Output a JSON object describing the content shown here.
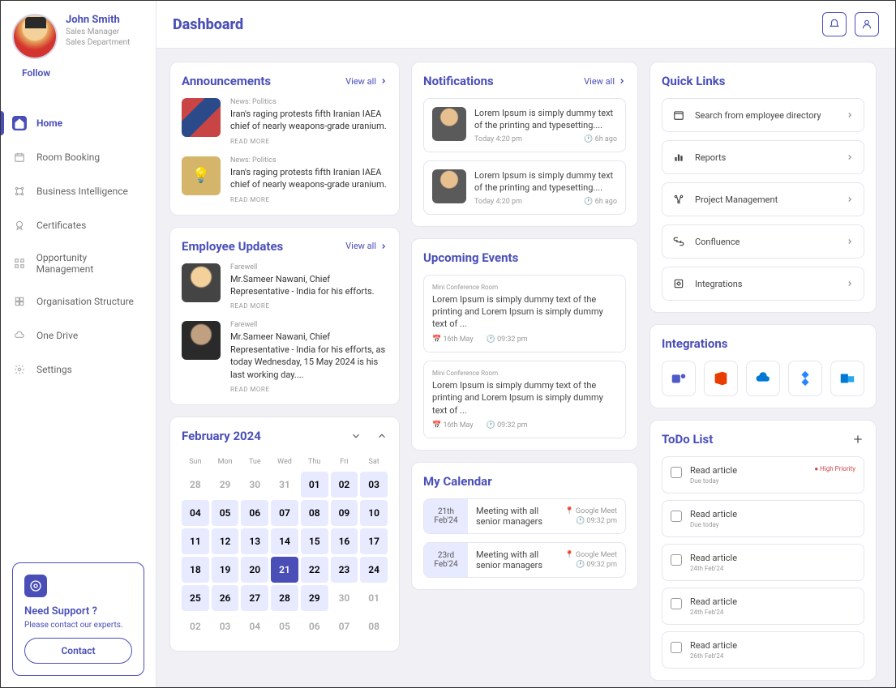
{
  "profile": {
    "name": "John Smith",
    "role": "Sales Manager",
    "dept": "Sales Department",
    "follow": "Follow"
  },
  "nav": [
    {
      "label": "Home",
      "active": true
    },
    {
      "label": "Room Booking"
    },
    {
      "label": "Business Intelligence"
    },
    {
      "label": "Certificates"
    },
    {
      "label": "Opportunity Management"
    },
    {
      "label": "Organisation Structure"
    },
    {
      "label": "One Drive"
    },
    {
      "label": "Settings"
    }
  ],
  "support": {
    "title": "Need Support ?",
    "sub": "Please contact our experts.",
    "btn": "Contact"
  },
  "page_title": "Dashboard",
  "view_all": "View all",
  "announcements": {
    "title": "Announcements",
    "items": [
      {
        "cat": "News: Politics",
        "txt": "Iran's raging protests fifth Iranian IAEA chief of nearly weapons-grade uranium.",
        "more": "READ MORE"
      },
      {
        "cat": "News: Politics",
        "txt": "Iran's raging protests fifth Iranian IAEA chief of nearly weapons-grade uranium.",
        "more": "READ MORE"
      }
    ]
  },
  "emp_updates": {
    "title": "Employee Updates",
    "items": [
      {
        "cat": "Farewell",
        "txt": "Mr.Sameer Nawani, Chief Representative - India for his efforts.",
        "more": "READ MORE"
      },
      {
        "cat": "Farewell",
        "txt": "Mr.Sameer Nawani, Chief Representative - India for his efforts, as today Wednesday, 15 May 2024 is his last working day....",
        "more": "READ MORE"
      }
    ]
  },
  "calendar": {
    "title": "February 2024",
    "dow": [
      "Sun",
      "Mon",
      "Tue",
      "Wed",
      "Thu",
      "Fri",
      "Sat"
    ],
    "days": [
      {
        "n": "28",
        "o": true
      },
      {
        "n": "29",
        "o": true
      },
      {
        "n": "30",
        "o": true
      },
      {
        "n": "31",
        "o": true
      },
      {
        "n": "01",
        "f": true
      },
      {
        "n": "02",
        "f": true
      },
      {
        "n": "03",
        "f": true
      },
      {
        "n": "04",
        "f": true
      },
      {
        "n": "05",
        "f": true
      },
      {
        "n": "06",
        "f": true
      },
      {
        "n": "07",
        "f": true
      },
      {
        "n": "08",
        "f": true
      },
      {
        "n": "09",
        "f": true
      },
      {
        "n": "10",
        "f": true
      },
      {
        "n": "11",
        "f": true
      },
      {
        "n": "12",
        "f": true
      },
      {
        "n": "13",
        "f": true
      },
      {
        "n": "14",
        "f": true
      },
      {
        "n": "15",
        "f": true
      },
      {
        "n": "16",
        "f": true
      },
      {
        "n": "17",
        "f": true
      },
      {
        "n": "18",
        "f": true
      },
      {
        "n": "19",
        "f": true
      },
      {
        "n": "20",
        "f": true
      },
      {
        "n": "21",
        "a": true
      },
      {
        "n": "22",
        "f": true
      },
      {
        "n": "23",
        "f": true
      },
      {
        "n": "24",
        "f": true
      },
      {
        "n": "25",
        "f": true
      },
      {
        "n": "26",
        "f": true
      },
      {
        "n": "27",
        "f": true
      },
      {
        "n": "28",
        "f": true
      },
      {
        "n": "29",
        "f": true
      },
      {
        "n": "30",
        "o": true
      },
      {
        "n": "01",
        "o": true
      },
      {
        "n": "02",
        "o": true
      },
      {
        "n": "03",
        "o": true
      },
      {
        "n": "04",
        "o": true
      },
      {
        "n": "05",
        "o": true
      },
      {
        "n": "06",
        "o": true
      },
      {
        "n": "07",
        "o": true
      },
      {
        "n": "08",
        "o": true
      }
    ]
  },
  "notifications": {
    "title": "Notifications",
    "items": [
      {
        "txt": "Lorem Ipsum is simply dummy text of the printing and typesetting....",
        "time": "Today 4:20 pm",
        "ago": "6h ago"
      },
      {
        "txt": "Lorem Ipsum is simply dummy text of the printing and typesetting....",
        "time": "Today 4:20 pm",
        "ago": "6h ago"
      }
    ]
  },
  "events": {
    "title": "Upcoming Events",
    "items": [
      {
        "loc": "Mini Conference Room",
        "txt": "Lorem Ipsum is simply dummy text of the printing and Lorem Ipsum is simply dummy text of ...",
        "date": "16th May",
        "time": "09:32 pm"
      },
      {
        "loc": "Mini Conference Room",
        "txt": "Lorem Ipsum is simply dummy text of the printing and Lorem Ipsum is simply dummy text of ...",
        "date": "16th May",
        "time": "09:32 pm"
      }
    ]
  },
  "mycal": {
    "title": "My Calendar",
    "items": [
      {
        "date1": "21th",
        "date2": "Feb'24",
        "txt": "Meeting with all senior managers",
        "loc": "Google Meet",
        "time": "09:32 pm"
      },
      {
        "date1": "23rd",
        "date2": "Feb'24",
        "txt": "Meeting with all senior managers",
        "loc": "Google Meet",
        "time": "09:32 pm"
      }
    ]
  },
  "quicklinks": {
    "title": "Quick Links",
    "items": [
      {
        "label": "Search from employee directory"
      },
      {
        "label": "Reports"
      },
      {
        "label": "Project Management"
      },
      {
        "label": "Confluence"
      },
      {
        "label": "Integrations"
      }
    ]
  },
  "integrations": {
    "title": "Integrations"
  },
  "todo": {
    "title": "ToDo List",
    "items": [
      {
        "title": "Read article",
        "sub": "Due today",
        "prio": "High Priority"
      },
      {
        "title": "Read article",
        "sub": "Due today"
      },
      {
        "title": "Read article",
        "sub": "24th Feb'24"
      },
      {
        "title": "Read article",
        "sub": "24th Feb'24"
      },
      {
        "title": "Read article",
        "sub": "26th Feb'24"
      }
    ]
  }
}
